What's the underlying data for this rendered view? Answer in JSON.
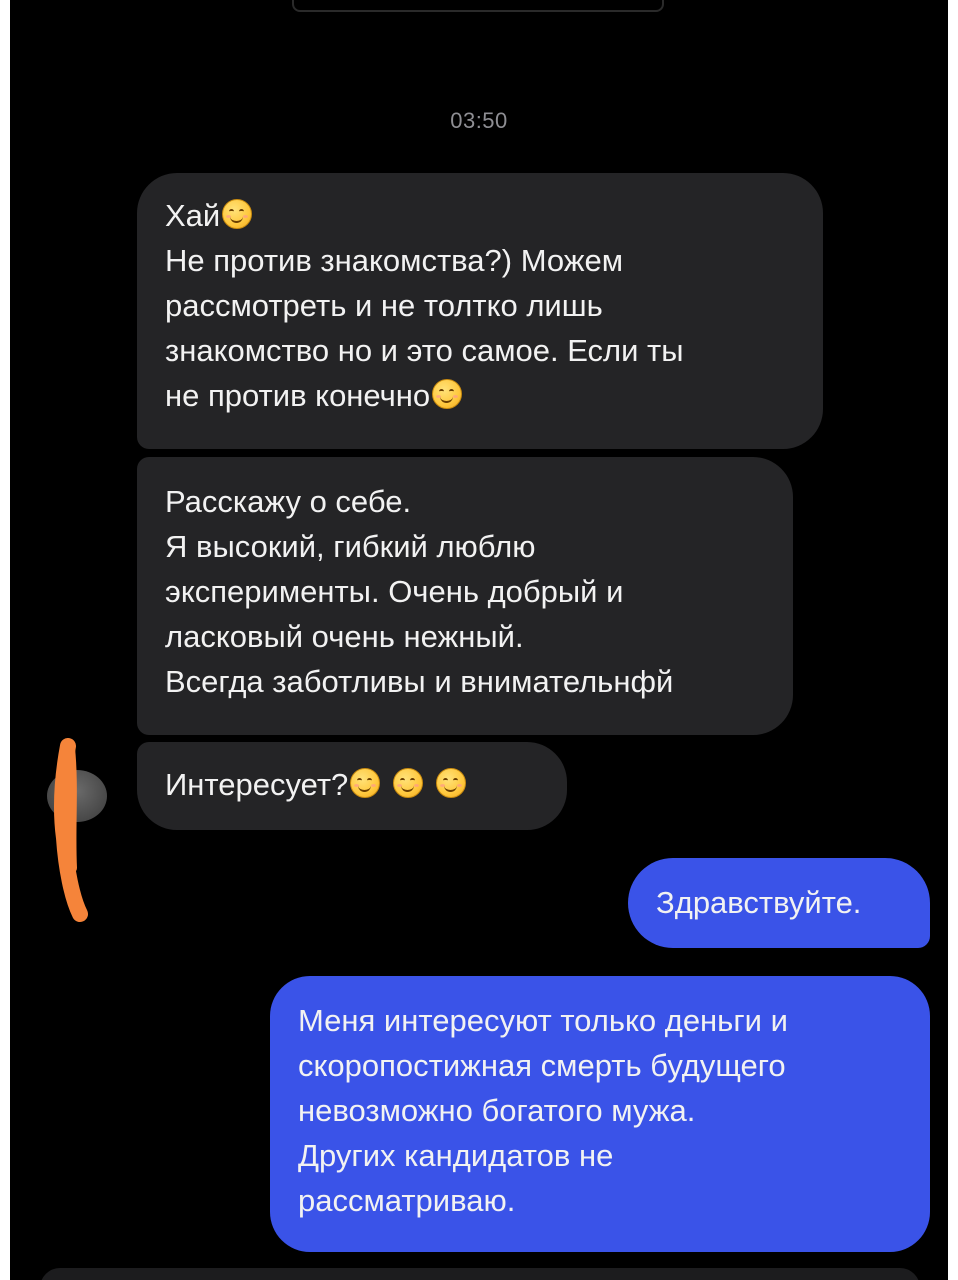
{
  "chat": {
    "timestamp": "03:50",
    "incoming": [
      {
        "lines": [
          {
            "text": "Хай",
            "emoji": true
          },
          {
            "text": "Не против знакомства?) Можем"
          },
          {
            "text": "рассмотреть и не толтко лишь"
          },
          {
            "text": "знакомство но и это самое. Если ты"
          },
          {
            "text": "не против конечно",
            "emoji": true
          }
        ]
      },
      {
        "lines": [
          {
            "text": "Расскажу о себе."
          },
          {
            "text": "Я высокий, гибкий люблю"
          },
          {
            "text": "эксперименты. Очень добрый и"
          },
          {
            "text": "ласковый очень нежный."
          },
          {
            "text": "Всегда заботливы и внимательнфй"
          }
        ]
      },
      {
        "lines": [
          {
            "text": "Интересует?",
            "emoji_count": 3
          }
        ]
      }
    ],
    "outgoing": [
      {
        "lines": [
          {
            "text": "Здравствуйте."
          }
        ]
      },
      {
        "lines": [
          {
            "text": "Меня интересуют только деньги и"
          },
          {
            "text": "скоропостижная смерть будущего"
          },
          {
            "text": "невозможно богатого мужа."
          },
          {
            "text": "Других кандидатов не"
          },
          {
            "text": "рассматриваю."
          }
        ]
      }
    ]
  },
  "icons": {
    "emoji": "smiling-face-icon",
    "avatar": "contact-avatar"
  },
  "colors": {
    "background": "#000000",
    "incoming_bubble": "#242426",
    "outgoing_bubble": "#3a53e8",
    "timestamp": "#8e8e93",
    "redaction_mark": "#f5843a"
  }
}
